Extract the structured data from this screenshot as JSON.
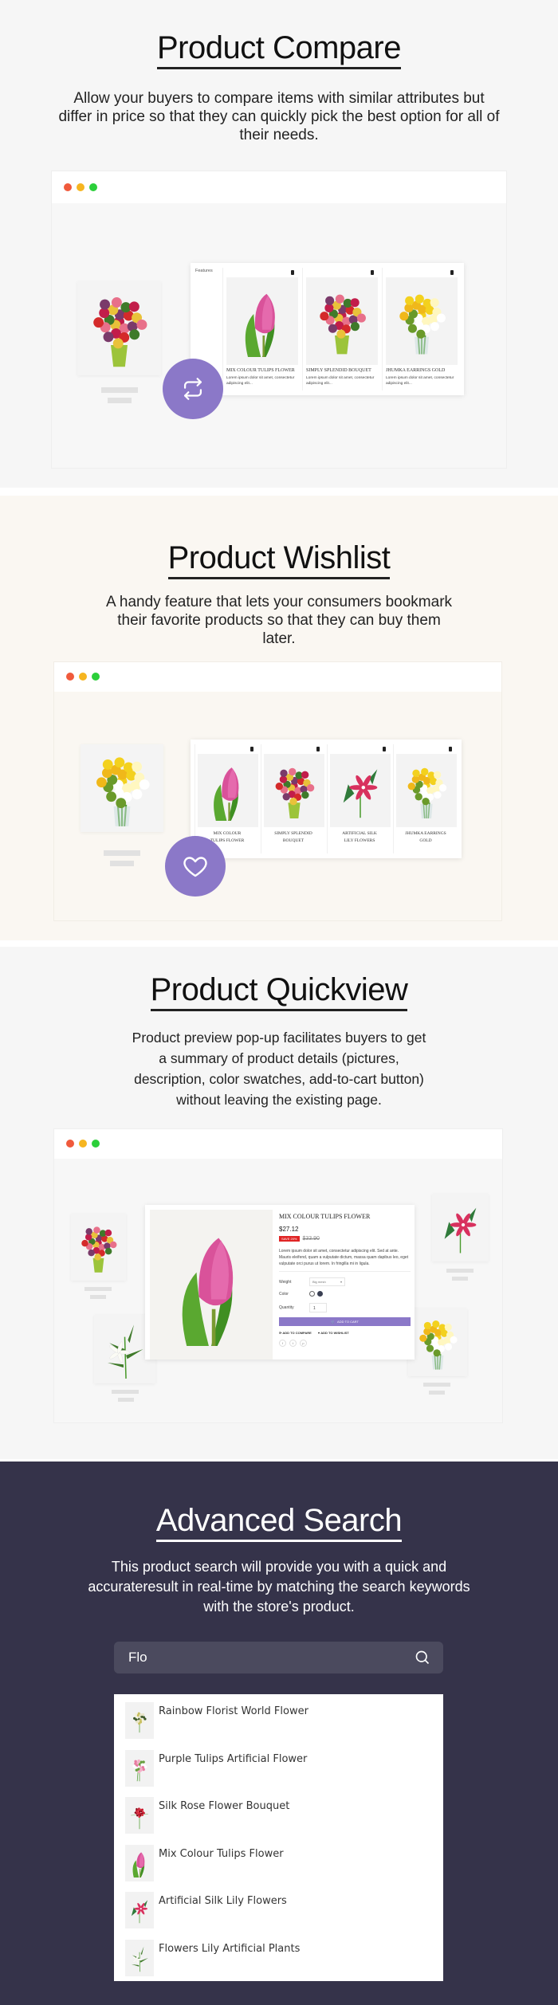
{
  "colors": {
    "accent": "#8b78c8",
    "dark_bg": "#35334a",
    "dot_red": "#f05a3c",
    "dot_yellow": "#f6b520",
    "dot_green": "#2bcf3a",
    "sale": "#e02424"
  },
  "compare": {
    "title": "Product Compare",
    "description": "Allow your buyers to compare items with similar attributes but differ in price so that they can quickly pick the best option for all of their needs.",
    "features_label": "Features",
    "products": [
      {
        "name": "Mix Colour Tulips Flower",
        "desc": "Lorem ipsum dolor sit amet, consectetur adipiscing elit...",
        "image": "tulip"
      },
      {
        "name": "Simply Splendid Bouquet",
        "desc": "Lorem ipsum dolor sit amet, consectetur adipiscing elit...",
        "image": "bouquet-mixed"
      },
      {
        "name": "Jhumka Earrings Gold",
        "desc": "Lorem ipsum dolor sit amet, consectetur adipiscing elit...",
        "image": "bouquet-yellow"
      }
    ],
    "icon": "compare-arrows-icon"
  },
  "wishlist": {
    "title": "Product Wishlist",
    "description": "A handy feature that lets your consumers bookmark their favorite products so that they can buy them later.",
    "products": [
      {
        "name": "Mix Colour Tulips Flower",
        "image": "tulip"
      },
      {
        "name": "Simply Splendid Bouquet",
        "image": "bouquet-mixed"
      },
      {
        "name": "Artificial Silk Lily Flowers",
        "image": "lily-pink"
      },
      {
        "name": "Jhumka Earrings Gold",
        "image": "bouquet-yellow"
      }
    ],
    "icon": "heart-icon"
  },
  "quickview": {
    "title": "Product Quickview",
    "description": "Product preview pop-up facilitates buyers to get a summary of product details (pictures, description, color swatches, add-to-cart button) without leaving the existing page.",
    "product_name": "Mix Colour Tulips Flower",
    "price": "$27.12",
    "save_badge": "SAVE 20%",
    "old_price": "$33.90",
    "product_desc": "Lorem ipsum dolor sit amet, consectetur adipiscing elit. Sed at ante. Mauris eleifend, quam a vulputate dictum, massa quam dapibus leo, eget vulputate orci purus ut lorem. In fringilla mi in ligula.",
    "weight_label": "Weight",
    "weight_value": "Big mesh",
    "color_label": "Color",
    "quantity_label": "Quantity",
    "quantity_value": "1",
    "add_to_cart": "ADD TO CART",
    "add_to_compare": "ADD TO COMPARE",
    "add_to_wishlist": "ADD TO WISHLIST",
    "social": [
      "f",
      "t",
      "p"
    ]
  },
  "search": {
    "title": "Advanced Search",
    "description": "This product search will provide you with a quick and accurateresult in real-time by matching the search keywords with the store's product.",
    "query": "Flo",
    "results": [
      {
        "name": "Rainbow Florist World Flower",
        "image": "bouquet-white"
      },
      {
        "name": "Purple Tulips Artificial Flower",
        "image": "tulips-pink"
      },
      {
        "name": "Silk Rose Flower Bouquet",
        "image": "rose-red"
      },
      {
        "name": "Mix Colour Tulips Flower",
        "image": "tulip"
      },
      {
        "name": "Artificial Silk Lily Flowers",
        "image": "lily-pink"
      },
      {
        "name": "Flowers Lily Artificial Plants",
        "image": "lily-white"
      }
    ]
  }
}
